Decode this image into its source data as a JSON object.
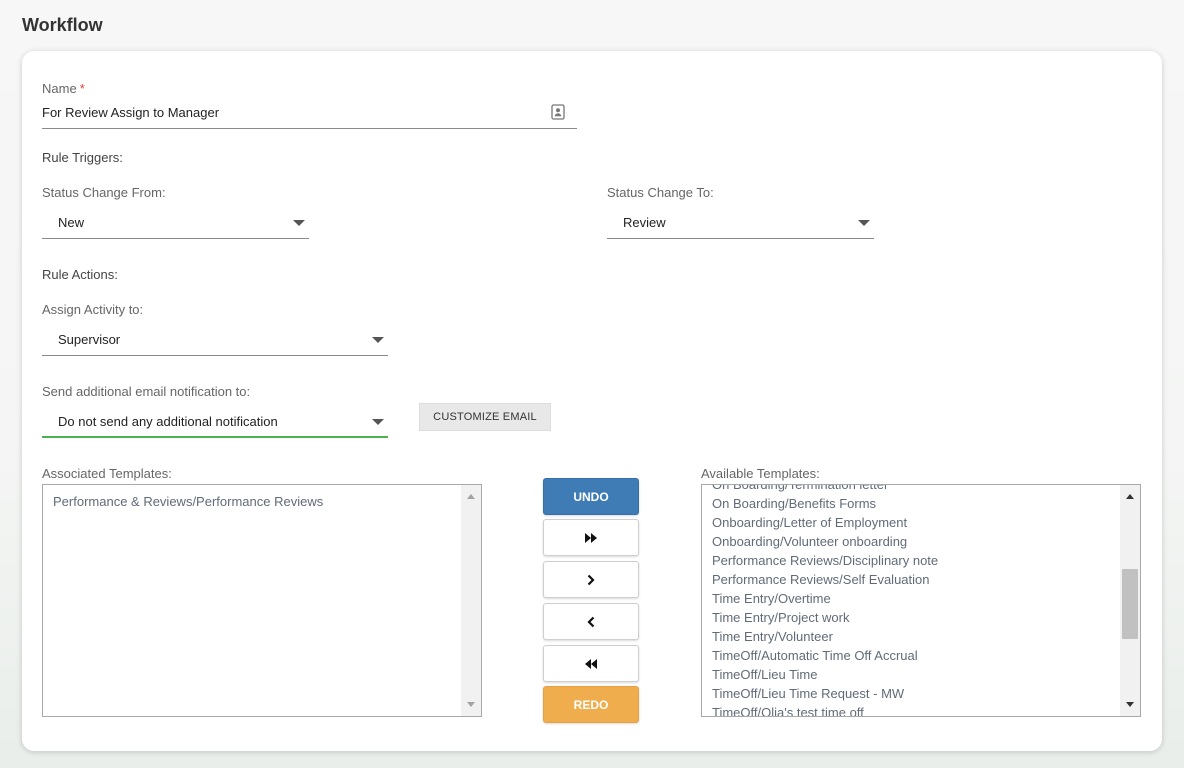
{
  "page": {
    "title": "Workflow"
  },
  "form": {
    "name": {
      "label": "Name",
      "required_mark": "*",
      "value": "For Review Assign to Manager"
    },
    "rule_triggers_label": "Rule Triggers:",
    "status_from": {
      "label": "Status Change From:",
      "value": "New"
    },
    "status_to": {
      "label": "Status Change To:",
      "value": "Review"
    },
    "rule_actions_label": "Rule Actions:",
    "assign_to": {
      "label": "Assign Activity to:",
      "value": "Supervisor"
    },
    "email_notify": {
      "label": "Send additional email notification to:",
      "value": "Do not send any additional notification"
    },
    "customize_email_label": "CUSTOMIZE EMAIL"
  },
  "associated": {
    "label": "Associated Templates:",
    "items": [
      "Performance & Reviews/Performance Reviews"
    ]
  },
  "available": {
    "label": "Available Templates:",
    "items": [
      "On Boarding/Termination letter",
      "On Boarding/Benefits Forms",
      "Onboarding/Letter of Employment",
      "Onboarding/Volunteer onboarding",
      "Performance Reviews/Disciplinary note",
      "Performance Reviews/Self Evaluation",
      "Time Entry/Overtime",
      "Time Entry/Project work",
      "Time Entry/Volunteer",
      "TimeOff/Automatic Time Off Accrual",
      "TimeOff/Lieu Time",
      "TimeOff/Lieu Time Request - MW",
      "TimeOff/Olia's test time off"
    ]
  },
  "transfer": {
    "undo_label": "UNDO",
    "redo_label": "REDO",
    "icons": [
      "double-chevron-right-icon",
      "chevron-right-icon",
      "chevron-left-icon",
      "double-chevron-left-icon"
    ]
  },
  "colors": {
    "undo": "#3f7bb5",
    "redo": "#f0ad4e",
    "focus_underline": "#4caf50",
    "required": "#e53935"
  }
}
